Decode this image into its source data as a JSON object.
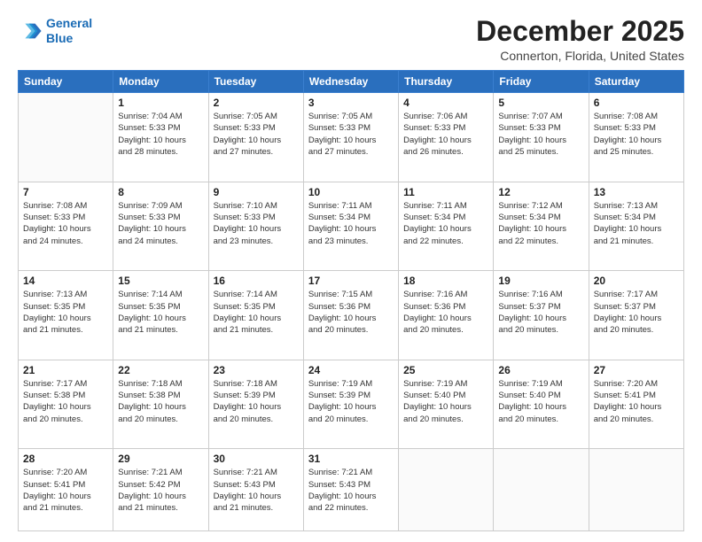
{
  "logo": {
    "line1": "General",
    "line2": "Blue"
  },
  "header": {
    "month": "December 2025",
    "location": "Connerton, Florida, United States"
  },
  "days_of_week": [
    "Sunday",
    "Monday",
    "Tuesday",
    "Wednesday",
    "Thursday",
    "Friday",
    "Saturday"
  ],
  "weeks": [
    [
      {
        "day": "",
        "info": ""
      },
      {
        "day": "1",
        "info": "Sunrise: 7:04 AM\nSunset: 5:33 PM\nDaylight: 10 hours\nand 28 minutes."
      },
      {
        "day": "2",
        "info": "Sunrise: 7:05 AM\nSunset: 5:33 PM\nDaylight: 10 hours\nand 27 minutes."
      },
      {
        "day": "3",
        "info": "Sunrise: 7:05 AM\nSunset: 5:33 PM\nDaylight: 10 hours\nand 27 minutes."
      },
      {
        "day": "4",
        "info": "Sunrise: 7:06 AM\nSunset: 5:33 PM\nDaylight: 10 hours\nand 26 minutes."
      },
      {
        "day": "5",
        "info": "Sunrise: 7:07 AM\nSunset: 5:33 PM\nDaylight: 10 hours\nand 25 minutes."
      },
      {
        "day": "6",
        "info": "Sunrise: 7:08 AM\nSunset: 5:33 PM\nDaylight: 10 hours\nand 25 minutes."
      }
    ],
    [
      {
        "day": "7",
        "info": "Sunrise: 7:08 AM\nSunset: 5:33 PM\nDaylight: 10 hours\nand 24 minutes."
      },
      {
        "day": "8",
        "info": "Sunrise: 7:09 AM\nSunset: 5:33 PM\nDaylight: 10 hours\nand 24 minutes."
      },
      {
        "day": "9",
        "info": "Sunrise: 7:10 AM\nSunset: 5:33 PM\nDaylight: 10 hours\nand 23 minutes."
      },
      {
        "day": "10",
        "info": "Sunrise: 7:11 AM\nSunset: 5:34 PM\nDaylight: 10 hours\nand 23 minutes."
      },
      {
        "day": "11",
        "info": "Sunrise: 7:11 AM\nSunset: 5:34 PM\nDaylight: 10 hours\nand 22 minutes."
      },
      {
        "day": "12",
        "info": "Sunrise: 7:12 AM\nSunset: 5:34 PM\nDaylight: 10 hours\nand 22 minutes."
      },
      {
        "day": "13",
        "info": "Sunrise: 7:13 AM\nSunset: 5:34 PM\nDaylight: 10 hours\nand 21 minutes."
      }
    ],
    [
      {
        "day": "14",
        "info": "Sunrise: 7:13 AM\nSunset: 5:35 PM\nDaylight: 10 hours\nand 21 minutes."
      },
      {
        "day": "15",
        "info": "Sunrise: 7:14 AM\nSunset: 5:35 PM\nDaylight: 10 hours\nand 21 minutes."
      },
      {
        "day": "16",
        "info": "Sunrise: 7:14 AM\nSunset: 5:35 PM\nDaylight: 10 hours\nand 21 minutes."
      },
      {
        "day": "17",
        "info": "Sunrise: 7:15 AM\nSunset: 5:36 PM\nDaylight: 10 hours\nand 20 minutes."
      },
      {
        "day": "18",
        "info": "Sunrise: 7:16 AM\nSunset: 5:36 PM\nDaylight: 10 hours\nand 20 minutes."
      },
      {
        "day": "19",
        "info": "Sunrise: 7:16 AM\nSunset: 5:37 PM\nDaylight: 10 hours\nand 20 minutes."
      },
      {
        "day": "20",
        "info": "Sunrise: 7:17 AM\nSunset: 5:37 PM\nDaylight: 10 hours\nand 20 minutes."
      }
    ],
    [
      {
        "day": "21",
        "info": "Sunrise: 7:17 AM\nSunset: 5:38 PM\nDaylight: 10 hours\nand 20 minutes."
      },
      {
        "day": "22",
        "info": "Sunrise: 7:18 AM\nSunset: 5:38 PM\nDaylight: 10 hours\nand 20 minutes."
      },
      {
        "day": "23",
        "info": "Sunrise: 7:18 AM\nSunset: 5:39 PM\nDaylight: 10 hours\nand 20 minutes."
      },
      {
        "day": "24",
        "info": "Sunrise: 7:19 AM\nSunset: 5:39 PM\nDaylight: 10 hours\nand 20 minutes."
      },
      {
        "day": "25",
        "info": "Sunrise: 7:19 AM\nSunset: 5:40 PM\nDaylight: 10 hours\nand 20 minutes."
      },
      {
        "day": "26",
        "info": "Sunrise: 7:19 AM\nSunset: 5:40 PM\nDaylight: 10 hours\nand 20 minutes."
      },
      {
        "day": "27",
        "info": "Sunrise: 7:20 AM\nSunset: 5:41 PM\nDaylight: 10 hours\nand 20 minutes."
      }
    ],
    [
      {
        "day": "28",
        "info": "Sunrise: 7:20 AM\nSunset: 5:41 PM\nDaylight: 10 hours\nand 21 minutes."
      },
      {
        "day": "29",
        "info": "Sunrise: 7:21 AM\nSunset: 5:42 PM\nDaylight: 10 hours\nand 21 minutes."
      },
      {
        "day": "30",
        "info": "Sunrise: 7:21 AM\nSunset: 5:43 PM\nDaylight: 10 hours\nand 21 minutes."
      },
      {
        "day": "31",
        "info": "Sunrise: 7:21 AM\nSunset: 5:43 PM\nDaylight: 10 hours\nand 22 minutes."
      },
      {
        "day": "",
        "info": ""
      },
      {
        "day": "",
        "info": ""
      },
      {
        "day": "",
        "info": ""
      }
    ]
  ]
}
